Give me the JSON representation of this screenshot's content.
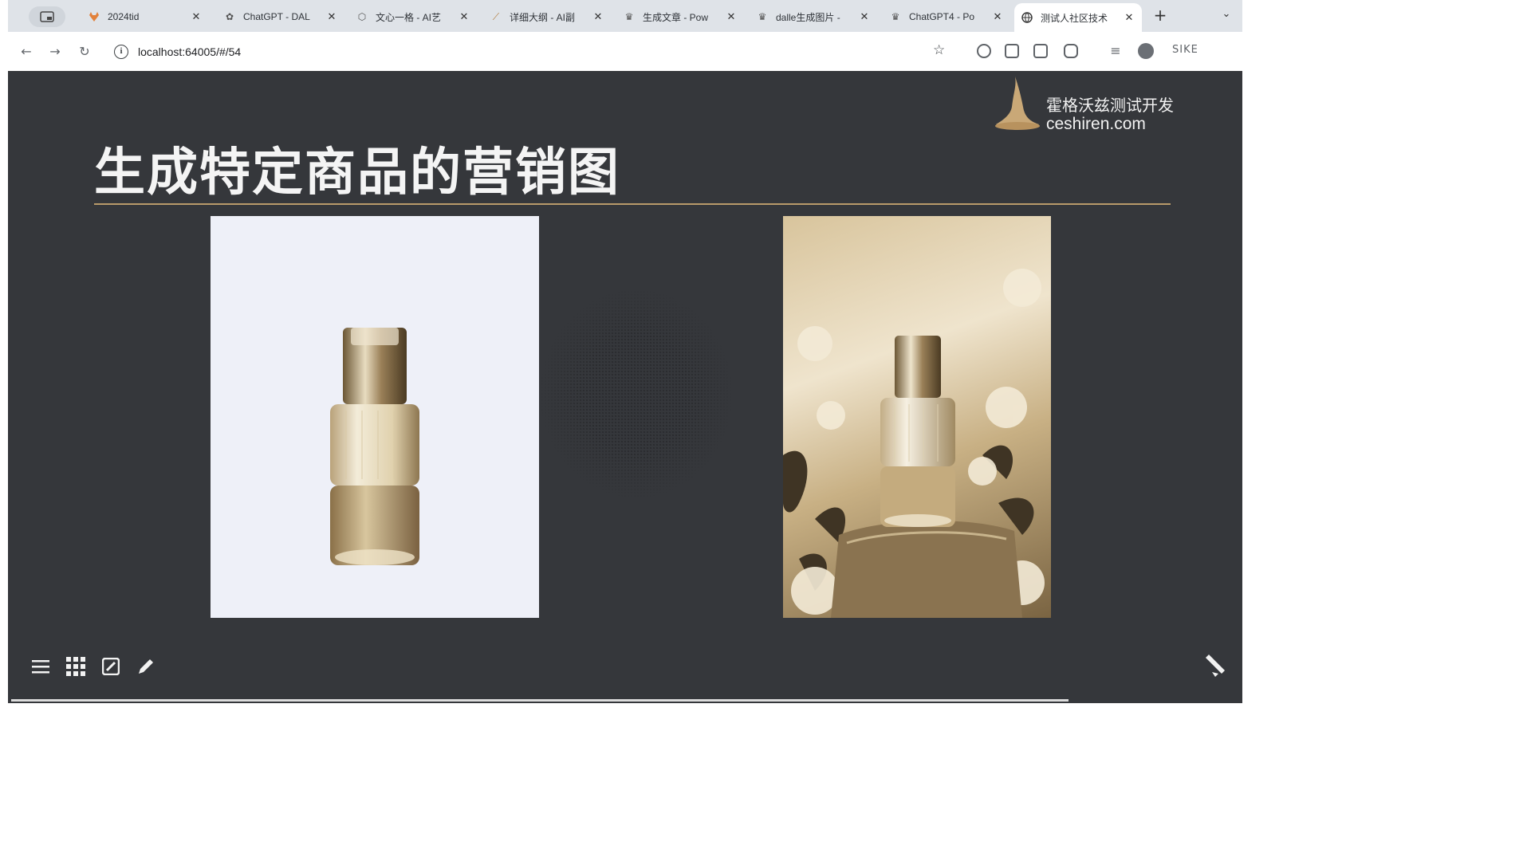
{
  "browser": {
    "tabs": [
      {
        "title": "2024tid",
        "icon": "gitlab-fox-icon",
        "active": false
      },
      {
        "title": "ChatGPT - DAL",
        "icon": "openai-icon",
        "active": false
      },
      {
        "title": "文心一格 - AI艺",
        "icon": "cube-icon",
        "active": false
      },
      {
        "title": "详细大纲 - AI副",
        "icon": "quill-icon",
        "active": false
      },
      {
        "title": "生成文章 - Pow",
        "icon": "poe-icon",
        "active": false
      },
      {
        "title": "dalle生成图片 -",
        "icon": "poe-icon",
        "active": false
      },
      {
        "title": "ChatGPT4 - Po",
        "icon": "poe-icon",
        "active": false
      },
      {
        "title": "测试人社区技术",
        "icon": "globe-icon",
        "active": true
      }
    ],
    "url": "localhost:64005/#/54",
    "profile_label": "SIKE"
  },
  "slide": {
    "logo_cn": "霍格沃兹测试开发",
    "logo_en": "ceshiren.com",
    "title": "生成特定商品的营销图",
    "accent_color": "#b89a6a",
    "background_color": "#35373b"
  }
}
